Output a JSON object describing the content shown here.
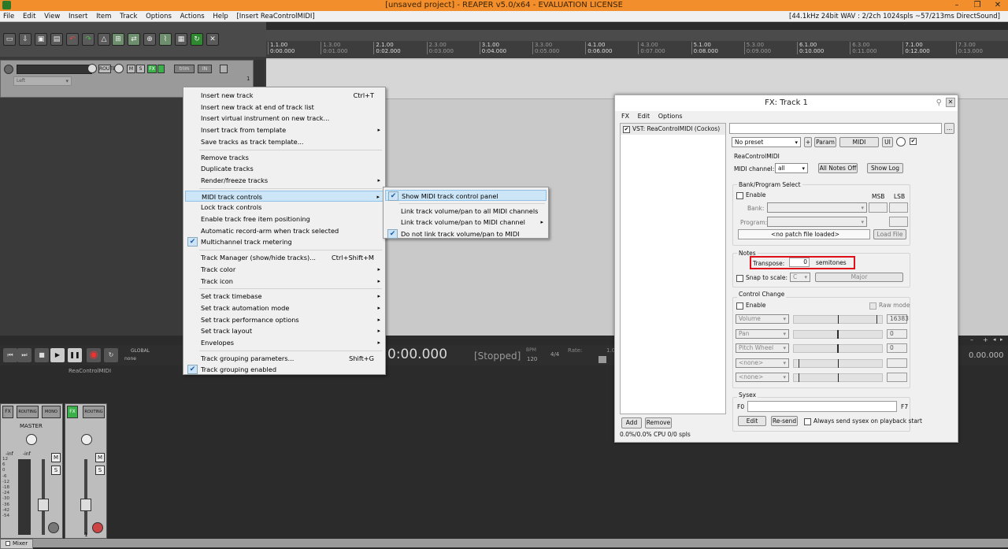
{
  "window": {
    "title": "[unsaved project] - REAPER v5.0/x64 - EVALUATION LICENSE"
  },
  "menubar": {
    "items": [
      "File",
      "Edit",
      "View",
      "Insert",
      "Item",
      "Track",
      "Options",
      "Actions",
      "Help",
      "[Insert ReaControlMIDI]"
    ],
    "status": "[44.1kHz 24bit WAV : 2/2ch 1024spls ~57/213ms DirectSound]"
  },
  "ruler": {
    "marks": [
      {
        "bar": "1.1.00",
        "time": "0:00.000",
        "major": true
      },
      {
        "bar": "1.3.00",
        "time": "0:01.000",
        "major": false
      },
      {
        "bar": "2.1.00",
        "time": "0:02.000",
        "major": true
      },
      {
        "bar": "2.3.00",
        "time": "0:03.000",
        "major": false
      },
      {
        "bar": "3.1.00",
        "time": "0:04.000",
        "major": true
      },
      {
        "bar": "3.3.00",
        "time": "0:05.000",
        "major": false
      },
      {
        "bar": "4.1.00",
        "time": "0:06.000",
        "major": true
      },
      {
        "bar": "4.3.00",
        "time": "0:07.000",
        "major": false
      },
      {
        "bar": "5.1.00",
        "time": "0:08.000",
        "major": true
      },
      {
        "bar": "5.3.00",
        "time": "0:09.000",
        "major": false
      },
      {
        "bar": "6.1.00",
        "time": "0:10.000",
        "major": true
      },
      {
        "bar": "6.3.00",
        "time": "0:11.000",
        "major": false
      },
      {
        "bar": "7.1.00",
        "time": "0:12.000",
        "major": true
      },
      {
        "bar": "7.3.00",
        "time": "0:13.000",
        "major": false
      }
    ]
  },
  "track": {
    "number": "1",
    "input": "Left",
    "buttons": {
      "route": "ROUTE",
      "mute": "M",
      "solo": "S",
      "fx": "FX",
      "trim": "trim",
      "in": "IN"
    }
  },
  "transport": {
    "time": "0:00.000",
    "state": "[Stopped]",
    "bpm_label": "BPM",
    "bpm": "120",
    "timesig": "4/4",
    "rate_label": "Rate:",
    "rate": "1.0",
    "global_label": "GLOBAL",
    "global_value": "none",
    "right_time": "0.00.000",
    "track_name": "ReaControlMIDI"
  },
  "mixer": {
    "master_label": "MASTER",
    "routing": "ROUTING",
    "mono": "MONO",
    "fx": "FX",
    "mute": "M",
    "solo": "S",
    "inf": "-inf",
    "scale": [
      "12",
      "6",
      "0",
      "-6",
      "-12",
      "-18",
      "-24",
      "-30",
      "-36",
      "-42",
      "-54"
    ],
    "track_number": "1",
    "tab": "Mixer"
  },
  "context_menu": {
    "items": [
      {
        "label": "Insert new track",
        "shortcut": "Ctrl+T"
      },
      {
        "label": "Insert new track at end of track list"
      },
      {
        "label": "Insert virtual instrument on new track..."
      },
      {
        "label": "Insert track from template",
        "submenu": true
      },
      {
        "label": "Save tracks as track template..."
      },
      {
        "sep": true
      },
      {
        "label": "Remove tracks"
      },
      {
        "label": "Duplicate tracks"
      },
      {
        "label": "Render/freeze tracks",
        "submenu": true
      },
      {
        "sep": true
      },
      {
        "label": "MIDI track controls",
        "submenu": true,
        "highlight": true
      },
      {
        "label": "Lock track controls"
      },
      {
        "label": "Enable track free item positioning"
      },
      {
        "label": "Automatic record-arm when track selected"
      },
      {
        "label": "Multichannel track metering",
        "checked": true
      },
      {
        "sep": true
      },
      {
        "label": "Track Manager (show/hide tracks)...",
        "shortcut": "Ctrl+Shift+M"
      },
      {
        "label": "Track color",
        "submenu": true
      },
      {
        "label": "Track icon",
        "submenu": true
      },
      {
        "sep": true
      },
      {
        "label": "Set track timebase",
        "submenu": true
      },
      {
        "label": "Set track automation mode",
        "submenu": true
      },
      {
        "label": "Set track performance options",
        "submenu": true
      },
      {
        "label": "Set track layout",
        "submenu": true
      },
      {
        "label": "Envelopes",
        "submenu": true
      },
      {
        "sep": true
      },
      {
        "label": "Track grouping parameters...",
        "shortcut": "Shift+G"
      },
      {
        "label": "Track grouping enabled",
        "checked": true
      }
    ]
  },
  "submenu": {
    "items": [
      {
        "label": "Show MIDI track control panel",
        "checked": true,
        "highlight": true
      },
      {
        "sep": true
      },
      {
        "label": "Link track volume/pan to all MIDI channels"
      },
      {
        "label": "Link track volume/pan to MIDI channel",
        "submenu": true
      },
      {
        "label": "Do not link track volume/pan to MIDI",
        "checked": true
      }
    ]
  },
  "fx_window": {
    "title": "FX: Track 1",
    "menu": [
      "FX",
      "Edit",
      "Options"
    ],
    "plugin": "VST: ReaControlMIDI (Cockos)",
    "add": "Add",
    "remove": "Remove",
    "cpu": "0.0%/0.0% CPU 0/0 spls",
    "ellipsis": "...",
    "preset": "No preset",
    "plus": "+",
    "param": "Param",
    "midi": "MIDI",
    "ui": "UI",
    "plugin_name": "ReaControlMIDI",
    "midi_channel_label": "MIDI channel:",
    "midi_channel": "all",
    "all_notes_off": "All Notes Off",
    "show_log": "Show Log",
    "bank_title": "Bank/Program Select",
    "enable": "Enable",
    "msb": "MSB",
    "lsb": "LSB",
    "bank": "Bank:",
    "program": "Program:",
    "patch": "<no patch file loaded>",
    "load_file": "Load File",
    "notes_title": "Notes",
    "transpose_label": "Transpose:",
    "transpose_value": "0",
    "semitones": "semitones",
    "snap_label": "Snap to scale:",
    "snap_key": "C",
    "snap_scale": "Major",
    "cc_title": "Control Change",
    "raw_mode": "Raw mode",
    "cc_rows": [
      {
        "name": "Volume",
        "value": "16383",
        "knob": 0.95
      },
      {
        "name": "Pan",
        "value": "0",
        "knob": 0.5
      },
      {
        "name": "Pitch Wheel",
        "value": "0",
        "knob": 0.5
      },
      {
        "name": "<none>",
        "value": "",
        "knob": 0.05
      },
      {
        "name": "<none>",
        "value": "",
        "knob": 0.05
      }
    ],
    "sysex_title": "Sysex",
    "f0": "F0",
    "f7": "F7",
    "edit": "Edit",
    "resend": "Re-send",
    "always_send": "Always send sysex on playback start",
    "highlight_color": "#e0101a"
  }
}
